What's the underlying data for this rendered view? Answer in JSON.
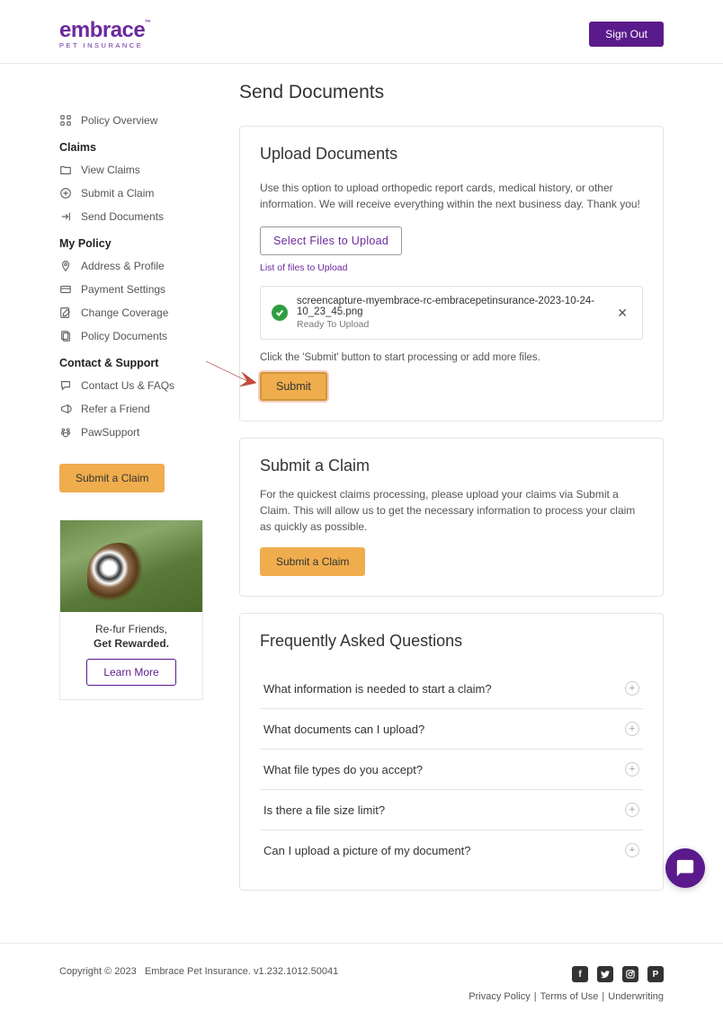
{
  "header": {
    "logo_main": "embrace",
    "logo_sub": "PET INSURANCE",
    "sign_out": "Sign Out"
  },
  "sidebar": {
    "items": [
      {
        "label": "Policy Overview"
      },
      {
        "label": "View Claims"
      },
      {
        "label": "Submit a Claim"
      },
      {
        "label": "Send Documents"
      },
      {
        "label": "Address & Profile"
      },
      {
        "label": "Payment Settings"
      },
      {
        "label": "Change Coverage"
      },
      {
        "label": "Policy Documents"
      },
      {
        "label": "Contact Us & FAQs"
      },
      {
        "label": "Refer a Friend"
      },
      {
        "label": "PawSupport"
      }
    ],
    "sections": {
      "claims": "Claims",
      "my_policy": "My Policy",
      "contact_support": "Contact & Support"
    },
    "submit_claim_btn": "Submit a Claim",
    "promo": {
      "line1": "Re-fur Friends,",
      "line2": "Get Rewarded.",
      "button": "Learn More"
    }
  },
  "main": {
    "page_title": "Send Documents",
    "upload": {
      "title": "Upload Documents",
      "description": "Use this option to upload orthopedic report cards, medical history, or other information. We will receive everything within the next business day. Thank you!",
      "select_files_btn": "Select Files to Upload",
      "file_list_link": "List of files to Upload",
      "file": {
        "name": "screencapture-myembrace-rc-embracepetinsurance-2023-10-24-10_23_45.png",
        "status": "Ready To Upload"
      },
      "help_text": "Click the 'Submit' button to start processing or add more files.",
      "submit_btn": "Submit"
    },
    "submit_claim": {
      "title": "Submit a Claim",
      "description": "For the quickest claims processing, please upload your claims via Submit a Claim. This will allow us to get the necessary information to process your claim as quickly as possible.",
      "button": "Submit a Claim"
    },
    "faq": {
      "title": "Frequently Asked Questions",
      "items": [
        {
          "question": "What information is needed to start a claim?"
        },
        {
          "question": "What documents can I upload?"
        },
        {
          "question": "What file types do you accept?"
        },
        {
          "question": "Is there a file size limit?"
        },
        {
          "question": "Can I upload a picture of my document?"
        }
      ]
    }
  },
  "footer": {
    "copyright": "Copyright © 2023",
    "company": "Embrace Pet Insurance. v1.232.1012.50041",
    "links": {
      "privacy": "Privacy Policy",
      "terms": "Terms of Use",
      "underwriting": "Underwriting"
    }
  }
}
